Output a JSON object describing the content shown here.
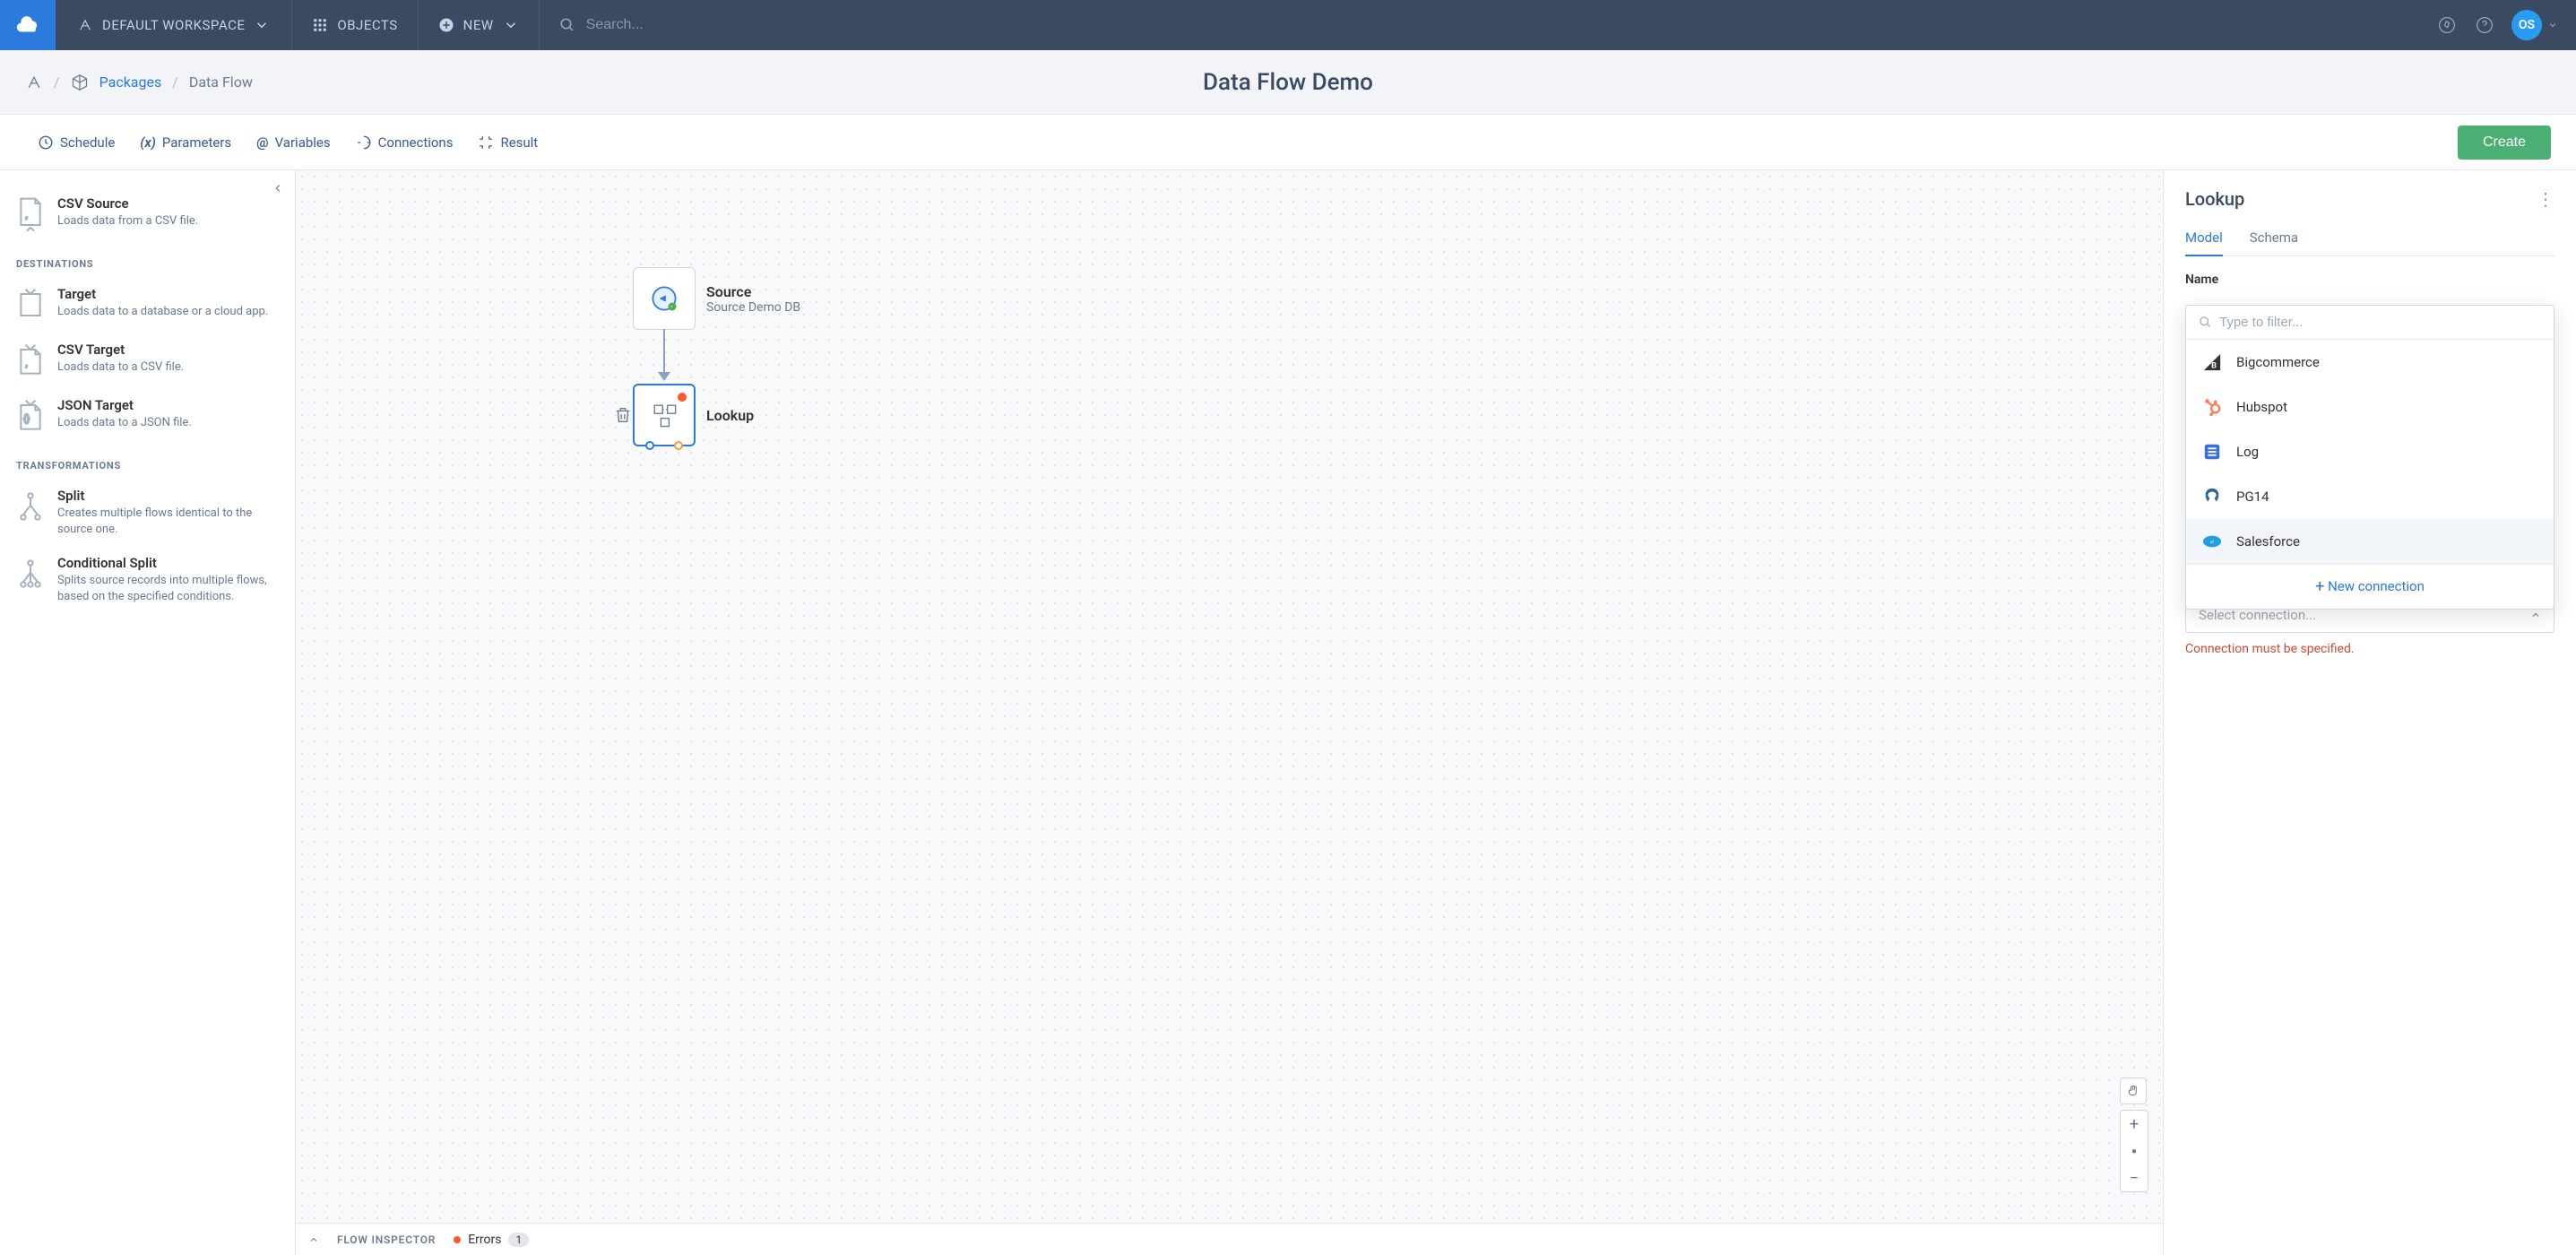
{
  "topbar": {
    "workspace_label": "DEFAULT WORKSPACE",
    "objects_label": "OBJECTS",
    "new_label": "NEW",
    "search_placeholder": "Search...",
    "avatar_initials": "OS"
  },
  "breadcrumb": {
    "packages": "Packages",
    "current": "Data Flow",
    "page_title": "Data Flow Demo"
  },
  "actions": {
    "schedule": "Schedule",
    "parameters": "Parameters",
    "variables": "Variables",
    "connections": "Connections",
    "result": "Result",
    "create": "Create"
  },
  "sidebar": {
    "sections": {
      "destinations": "DESTINATIONS",
      "transformations": "TRANSFORMATIONS"
    },
    "items": {
      "csv_source": {
        "title": "CSV Source",
        "desc": "Loads data from a CSV file."
      },
      "target": {
        "title": "Target",
        "desc": "Loads data to a database or a cloud app."
      },
      "csv_target": {
        "title": "CSV Target",
        "desc": "Loads data to a CSV file."
      },
      "json_target": {
        "title": "JSON Target",
        "desc": "Loads data to a JSON file."
      },
      "split": {
        "title": "Split",
        "desc": "Creates multiple flows identical to the source one."
      },
      "cond_split": {
        "title": "Conditional Split",
        "desc": "Splits source records into multiple flows, based on the specified conditions."
      }
    }
  },
  "canvas": {
    "nodes": {
      "source": {
        "name": "Source",
        "sub": "Source Demo DB"
      },
      "lookup": {
        "name": "Lookup"
      }
    },
    "inspector": {
      "label": "FLOW INSPECTOR",
      "errors_label": "Errors",
      "error_count": "1"
    }
  },
  "rpanel": {
    "title": "Lookup",
    "tabs": {
      "model": "Model",
      "schema": "Schema"
    },
    "name_label": "Name",
    "filter_placeholder": "Type to filter...",
    "connections": [
      {
        "name": "Bigcommerce",
        "icon": "bigcommerce",
        "color": "#333"
      },
      {
        "name": "Hubspot",
        "icon": "hubspot",
        "color": "#ff7a59"
      },
      {
        "name": "Log",
        "icon": "log",
        "color": "#3a6fd8"
      },
      {
        "name": "PG14",
        "icon": "postgres",
        "color": "#336791"
      },
      {
        "name": "Salesforce",
        "icon": "salesforce",
        "color": "#21a1db"
      }
    ],
    "new_connection": "New connection",
    "select_placeholder": "Select connection...",
    "error": "Connection must be specified."
  }
}
